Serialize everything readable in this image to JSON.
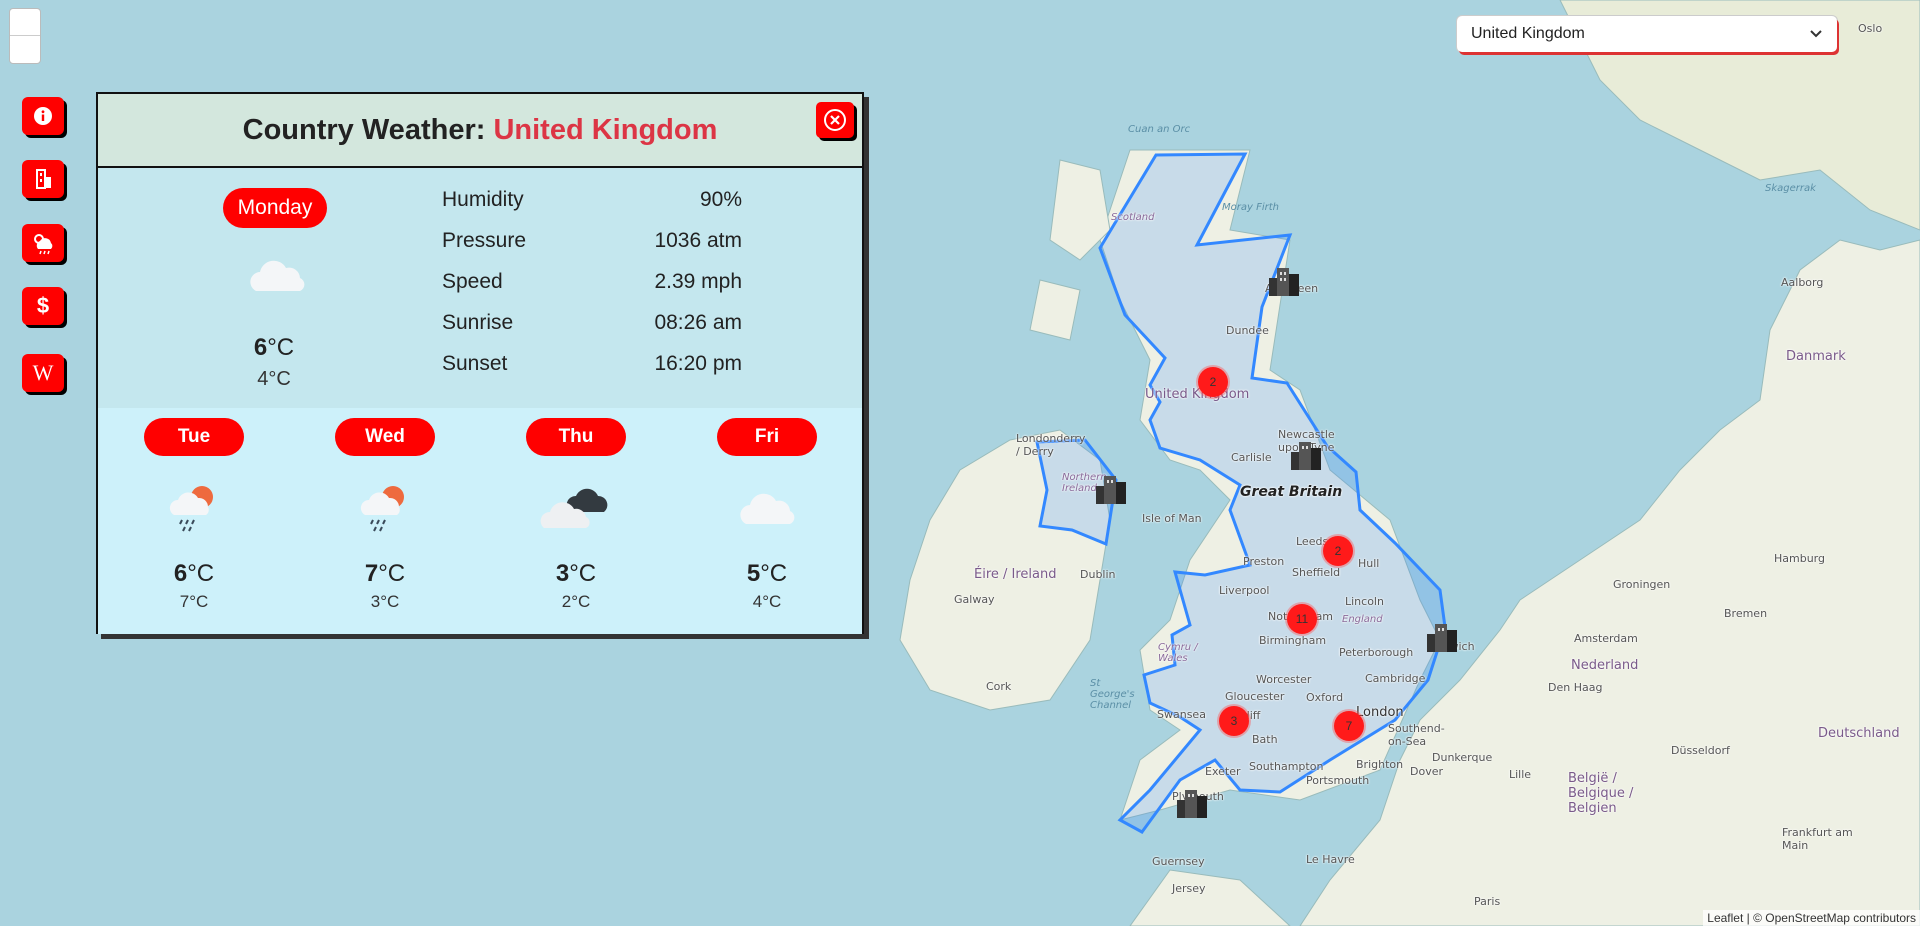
{
  "map": {
    "labels": {
      "uk": "United Kingdom",
      "great_britain": "Great Britain",
      "isle_of_man": "Isle of Man",
      "eire": "Éire / Ireland",
      "dublin": "Dublin",
      "galway": "Galway",
      "cork": "Cork",
      "londonderry": "Londonderry / Derry",
      "northern_ireland": "Northern Ireland",
      "scotland": "Scotland",
      "dundee": "Dundee",
      "aberdeen": "Aberdeen",
      "newcastle": "Newcastle upon Tyne",
      "carlisle": "Carlisle",
      "leeds": "Leeds",
      "hull": "Hull",
      "sheffield": "Sheffield",
      "preston": "Preston",
      "liverpool": "Liverpool",
      "lincoln": "Lincoln",
      "nottingham": "Nottingham",
      "birmingham": "Birmingham",
      "england": "England",
      "peterborough": "Peterborough",
      "norwich": "Norwich",
      "cambridge": "Cambridge",
      "worcester": "Worcester",
      "cymru": "Cymru / Wales",
      "gloucester": "Gloucester",
      "oxford": "Oxford",
      "london": "London",
      "swansea": "Swansea",
      "cardiff": "Cardiff",
      "bath": "Bath",
      "southend": "Southend-on-Sea",
      "exeter": "Exeter",
      "southampton": "Southampton",
      "brighton": "Brighton",
      "portsmouth": "Portsmouth",
      "plymouth": "Plymouth",
      "dover": "Dover",
      "dunkerque": "Dunkerque",
      "lille": "Lille",
      "guernsey": "Guernsey",
      "jersey": "Jersey",
      "le_havre": "Le Havre",
      "paris": "Paris",
      "oslo": "Oslo",
      "danmark": "Danmark",
      "aalborg": "Aalborg",
      "hamburg": "Hamburg",
      "bremen": "Bremen",
      "groningen": "Groningen",
      "nederland": "Nederland",
      "den_haag": "Den Haag",
      "amsterdam": "Amsterdam",
      "dusseldorf": "Düsseldorf",
      "belgie": "België / Belgique / Belgien",
      "deutschland": "Deutschland",
      "frankfurt": "Frankfurt am Main",
      "skagerrak": "Skagerrak",
      "st_georges": "St George's Channel",
      "moray": "Moray Firth",
      "cuan": "Cuan an Orc"
    },
    "clusters": [
      "2",
      "2",
      "11",
      "3",
      "7"
    ],
    "colors": {
      "uk_fill": "#b7c8e8",
      "uk_stroke": "#3388ff",
      "land": "#f2efe9",
      "sea": "#aad3df"
    }
  },
  "controls": {
    "zoom_icons": [
      "zoom-in",
      "zoom-out"
    ],
    "side_buttons": [
      {
        "name": "info-button",
        "icon": "info-icon"
      },
      {
        "name": "city-button",
        "icon": "building-icon"
      },
      {
        "name": "weather-button",
        "icon": "weather-icon"
      },
      {
        "name": "currency-button",
        "icon": "dollar-icon",
        "glyph": "$"
      },
      {
        "name": "wikipedia-button",
        "icon": "wikipedia-icon",
        "glyph": "W"
      }
    ]
  },
  "country_select": {
    "value": "United Kingdom"
  },
  "modal": {
    "title_prefix": "Country Weather:",
    "title_country": "United Kingdom",
    "today": {
      "day": "Monday",
      "icon": "cloud-icon",
      "tmax_value": "6",
      "tmax_unit": "°C",
      "tmin": "4°C"
    },
    "stats": [
      {
        "label": "Humidity",
        "value": "90%"
      },
      {
        "label": "Pressure",
        "value": "1036 atm"
      },
      {
        "label": "Speed",
        "value": "2.39 mph"
      },
      {
        "label": "Sunrise",
        "value": "08:26 am"
      },
      {
        "label": "Sunset",
        "value": "16:20 pm"
      }
    ],
    "forecast": [
      {
        "day": "Tue",
        "icon": "rain-sun-icon",
        "tmax_value": "6",
        "tmax_unit": "°C",
        "tmin": "7°C"
      },
      {
        "day": "Wed",
        "icon": "rain-sun-icon",
        "tmax_value": "7",
        "tmax_unit": "°C",
        "tmin": "3°C"
      },
      {
        "day": "Thu",
        "icon": "dark-cloud-icon",
        "tmax_value": "3",
        "tmax_unit": "°C",
        "tmin": "2°C"
      },
      {
        "day": "Fri",
        "icon": "cloud-icon",
        "tmax_value": "5",
        "tmax_unit": "°C",
        "tmin": "4°C"
      }
    ]
  },
  "attribution": "Leaflet | © OpenStreetMap contributors"
}
